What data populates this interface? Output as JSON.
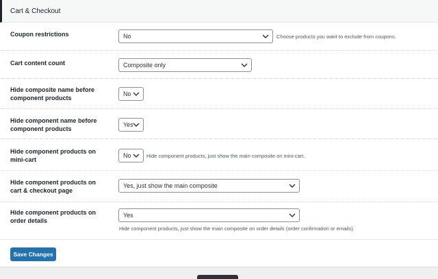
{
  "section": {
    "title": "Cart & Checkout"
  },
  "rows": [
    {
      "label": "Coupon restrictions",
      "value": "No",
      "help": "Choose products you want to exclude from coupons."
    },
    {
      "label": "Cart content count",
      "value": "Composite only",
      "help": ""
    },
    {
      "label": "Hide composite name before component products",
      "value": "No",
      "help": ""
    },
    {
      "label": "Hide component name before component products",
      "value": "Yes",
      "help": ""
    },
    {
      "label": "Hide component products on mini-cart",
      "value": "No",
      "help": "Hide component products, just show the main composite on mini-cart."
    },
    {
      "label": "Hide component products on cart & checkout page",
      "value": "Yes, just show the main composite",
      "help": ""
    },
    {
      "label": "Hide component products on order details",
      "value": "Yes",
      "help": "Hide component products, just show the main composite on order details (order confirmation or emails)."
    }
  ],
  "actions": {
    "save_label": "Save Changes"
  },
  "icons": {
    "select_arrow": "chevron-down-icon"
  },
  "colors": {
    "primary": "#2271b1",
    "text": "#1d2327",
    "border": "#8c8f94",
    "background": "#f0f0f1"
  }
}
